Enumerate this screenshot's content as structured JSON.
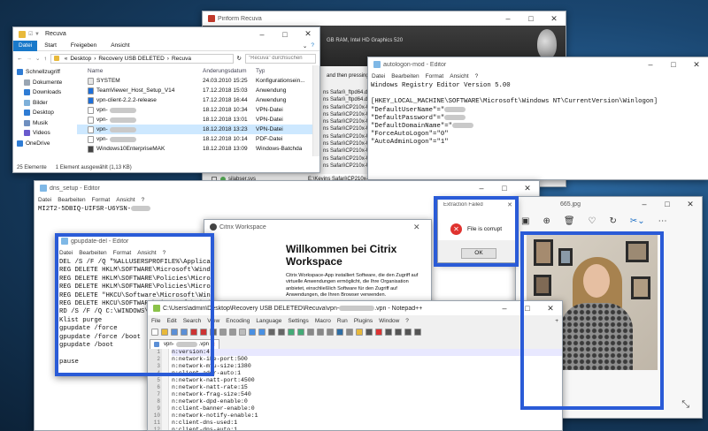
{
  "recuva": {
    "title": "Piriform Recuva",
    "spec": "GB RAM, Intel HD Graphics 520",
    "msg": "and then pressing t",
    "paths": [
      "ns Safari\\_ftpd64.dl",
      "ns Safari\\_ftpd64.d",
      "ns Safari\\CP210x-U",
      "ns Safari\\CP210x-U",
      "ns Safari\\CP210x-U",
      "ns Safari\\CP210x-U",
      "ns Safari\\CP210x-U",
      "ns Safari\\CP210x-U",
      "ns Safari\\CP210x-U",
      "ns Safari\\CP210x-U",
      "ns Safari\\CP210x-U"
    ],
    "bottom_file": "silabser.sys",
    "bottom_path": "E:\\Kevins Safari\\CP210x-U"
  },
  "explorer": {
    "title": "Recuva",
    "tabs": [
      "Datei",
      "Start",
      "Freigeben",
      "Ansicht"
    ],
    "breadcrumb": [
      "Desktop",
      "Recovery USB DELETED",
      "Recuva"
    ],
    "search_placeholder": "\"Recuva\" durchsuchen",
    "columns": [
      "Name",
      "Änderungsdatum",
      "Typ"
    ],
    "sidebar": [
      "Schnellzugriff",
      "Dokumente",
      "Downloads",
      "Bilder",
      "Desktop",
      "Musik",
      "Videos",
      "OneDrive"
    ],
    "files": [
      {
        "name": "SYSTEM",
        "date": "24.03.2010 15:25",
        "type": "Konfigurationsein..."
      },
      {
        "name": "TeamViewer_Host_Setup_V14",
        "date": "17.12.2018 15:03",
        "type": "Anwendung"
      },
      {
        "name": "vpn-client-2.2.2-release",
        "date": "17.12.2018 16:44",
        "type": "Anwendung"
      },
      {
        "name": "vpn-",
        "date": "18.12.2018 10:34",
        "type": "VPN-Datei"
      },
      {
        "name": "vpn-",
        "date": "18.12.2018 13:01",
        "type": "VPN-Datei"
      },
      {
        "name": "vpn-",
        "date": "18.12.2018 13:23",
        "type": "VPN-Datei"
      },
      {
        "name": "vpn-",
        "date": "18.12.2018 10:14",
        "type": "PDF-Datei"
      },
      {
        "name": "Windows10EnterpriseMAK",
        "date": "18.12.2018 13:09",
        "type": "Windows-Batchda"
      }
    ],
    "status_count": "25 Elemente",
    "status_selected": "1 Element ausgewählt (1,13 KB)"
  },
  "autologon": {
    "title": "autologon-mod - Editor",
    "menu": [
      "Datei",
      "Bearbeiten",
      "Format",
      "Ansicht",
      "?"
    ],
    "lines": [
      "Windows Registry Editor Version 5.00",
      "",
      "[HKEY_LOCAL_MACHINE\\SOFTWARE\\Microsoft\\Windows NT\\CurrentVersion\\Winlogon]",
      "\"DefaultUserName\"=\"",
      "\"DefaultPassword\"=\"",
      "\"DefaultDomainName\"=\"",
      "\"ForceAutoLogon\"=\"0\"",
      "\"AutoAdminLogon\"=\"1\""
    ]
  },
  "dns": {
    "title": "dns_setup - Editor",
    "menu": [
      "Datei",
      "Bearbeiten",
      "Format",
      "Ansicht",
      "?"
    ],
    "line": "MI2T2-5DBIQ-UIFSR-U6YSN-"
  },
  "gpupdate": {
    "title": "gpupdate-del - Editor",
    "menu": [
      "Datei",
      "Bearbeiten",
      "Format",
      "Ansicht",
      "?"
    ],
    "lines": [
      "DEL /S /F /Q \"%ALLUSERSPROFILE%\\Applicati",
      "REG DELETE HKLM\\SOFTWARE\\Microsoft\\Window",
      "REG DELETE HKLM\\SOFTWARE\\Policies\\Microso",
      "REG DELETE HKLM\\SOFTWARE\\Policies\\Microso",
      "REG DELETE \"HKCU\\Software\\Microsoft\\Windo",
      "REG DELETE HKCU\\SOFTWARE\\Microsoft\\Windo",
      "RD /S /F /Q C:\\WINDOWS\\sec",
      "Klist purge",
      "gpupdate /force",
      "gpupdate /force /boot",
      "gpupdate /boot",
      "",
      "pause"
    ]
  },
  "citrix": {
    "title": "Citrix Workspace",
    "heading": "Willkommen bei Citrix Workspace",
    "body": "Citrix Workspace-App installiert Software, die den Zugriff auf virtuelle Anwendungen ermöglicht, die Ihre Organisation anbietet, einschließlich Software für den Zugriff auf Anwendungen, die Ihren Browser verwenden."
  },
  "extraction": {
    "title": "Extraction Failed",
    "message": "File is corrupt",
    "ok": "OK"
  },
  "photos": {
    "title": "665.jpg"
  },
  "npp": {
    "title": "C:\\Users\\admin\\Desktop\\Recovery USB DELETED\\Recuva\\vpn-",
    "title_tail": ".vpn - Notepad++",
    "menu": [
      "File",
      "Edit",
      "Search",
      "View",
      "Encoding",
      "Language",
      "Settings",
      "Macro",
      "Run",
      "Plugins",
      "Window",
      "?"
    ],
    "tab": "vpn-",
    "tab_tail": ".vpn",
    "lines": [
      "n:version:4",
      "n:network-ike-port:500",
      "n:network-mtu-size:1380",
      "n:client-addr-auto:1",
      "n:network-natt-port:4500",
      "n:network-natt-rate:15",
      "n:network-frag-size:540",
      "n:network-dpd-enable:0",
      "n:client-banner-enable:0",
      "n:network-notify-enable:1",
      "n:client-dns-used:1",
      "n:client-dns-auto:1"
    ]
  },
  "colors": {
    "highlight": "#2a5bd7",
    "npp_green": "#2e8b57",
    "error_red": "#e0332f"
  }
}
